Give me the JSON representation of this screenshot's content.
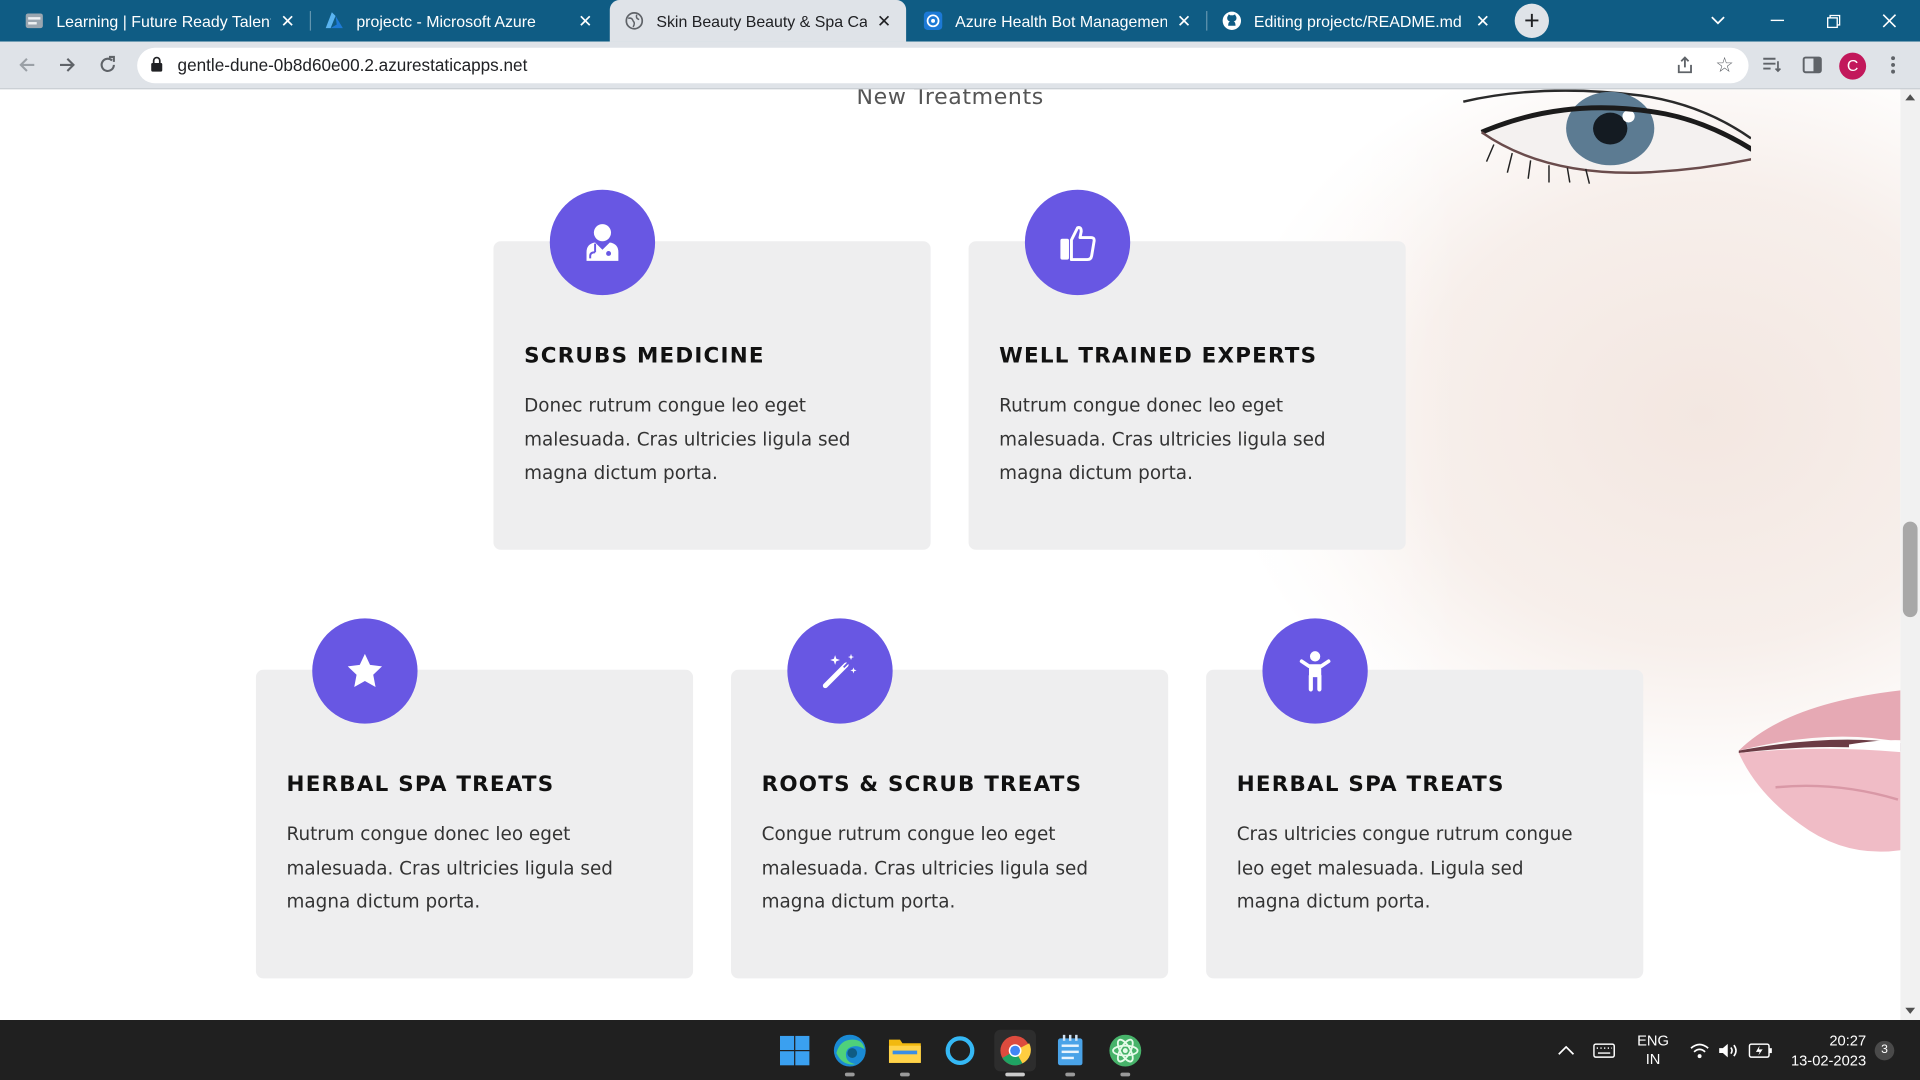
{
  "browser": {
    "tabs": [
      {
        "title": "Learning | Future Ready Talent",
        "icon": "learning-favicon"
      },
      {
        "title": "projectc - Microsoft Azure",
        "icon": "azure-favicon"
      },
      {
        "title": "Skin Beauty Beauty & Spa Catego",
        "icon": "globe-favicon",
        "active": true
      },
      {
        "title": "Azure Health Bot Management P",
        "icon": "health-bot-favicon"
      },
      {
        "title": "Editing projectc/README.md at m",
        "icon": "github-favicon"
      }
    ],
    "url": "gentle-dune-0b8d60e00.2.azurestaticapps.net",
    "profile_initial": "C"
  },
  "page": {
    "section_title": "New Treatments",
    "accent_color": "#6857e3",
    "cards": [
      {
        "icon": "doctor-icon",
        "title": "SCRUBS MEDICINE",
        "text": "Donec rutrum congue leo eget malesuada. Cras ultricies ligula sed magna dictum porta."
      },
      {
        "icon": "thumbs-up-icon",
        "title": "WELL TRAINED EXPERTS",
        "text": "Rutrum congue donec leo eget malesuada. Cras ultricies ligula sed magna dictum porta."
      },
      {
        "icon": "star-icon",
        "title": "HERBAL SPA TREATS",
        "text": "Rutrum congue donec leo eget malesuada. Cras ultricies ligula sed magna dictum porta."
      },
      {
        "icon": "magic-wand-icon",
        "title": "ROOTS & SCRUB TREATS",
        "text": "Congue rutrum congue leo eget malesuada. Cras ultricies ligula sed magna dictum porta."
      },
      {
        "icon": "child-icon",
        "title": "HERBAL SPA TREATS",
        "text": "Cras ultricies congue rutrum congue leo eget malesuada. Ligula sed magna dictum porta."
      }
    ]
  },
  "taskbar": {
    "apps": [
      "windows-start-icon",
      "edge-icon",
      "file-explorer-icon",
      "cortana-icon",
      "chrome-icon",
      "notepad-icon",
      "atom-icon"
    ],
    "language": "ENG",
    "region": "IN",
    "time": "20:27",
    "date": "13-02-2023",
    "notification_count": "3"
  }
}
